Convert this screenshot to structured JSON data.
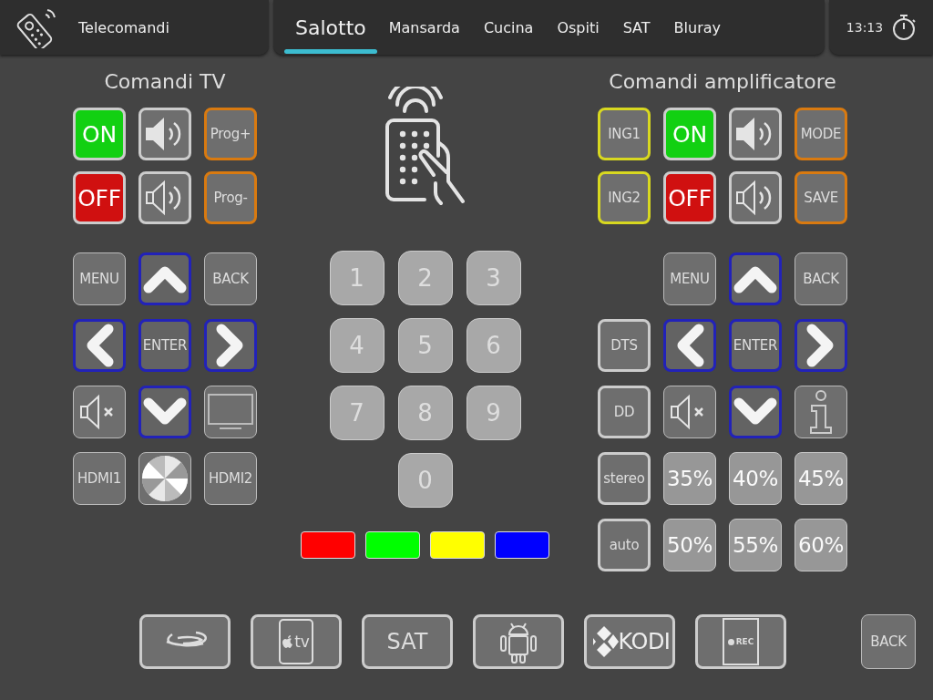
{
  "header": {
    "title": "Telecomandi",
    "tabs": [
      {
        "label": "Salotto",
        "selected": true
      },
      {
        "label": "Mansarda",
        "selected": false
      },
      {
        "label": "Cucina",
        "selected": false
      },
      {
        "label": "Ospiti",
        "selected": false
      },
      {
        "label": "SAT",
        "selected": false
      },
      {
        "label": "Bluray",
        "selected": false
      }
    ],
    "time": "13:13"
  },
  "tv_panel": {
    "title": "Comandi TV",
    "groups": [
      {
        "rows": [
          [
            {
              "kind": "power-on",
              "label": "ON"
            },
            {
              "kind": "vol-up"
            },
            {
              "kind": "program",
              "label": "Prog+"
            }
          ],
          [
            {
              "kind": "power-off",
              "label": "OFF"
            },
            {
              "kind": "vol-down"
            },
            {
              "kind": "program",
              "label": "Prog-"
            }
          ]
        ]
      },
      {
        "rows": [
          [
            {
              "kind": "plain",
              "label": "MENU"
            },
            {
              "kind": "up"
            },
            {
              "kind": "plain",
              "label": "BACK"
            }
          ],
          [
            {
              "kind": "left"
            },
            {
              "kind": "enter",
              "label": "ENTER"
            },
            {
              "kind": "right"
            }
          ],
          [
            {
              "kind": "mute"
            },
            {
              "kind": "down"
            },
            {
              "kind": "tv"
            }
          ],
          [
            {
              "kind": "plain",
              "label": "HDMI1"
            },
            {
              "kind": "disc"
            },
            {
              "kind": "plain",
              "label": "HDMI2"
            }
          ]
        ]
      }
    ]
  },
  "keypad": {
    "rows": [
      [
        "1",
        "2",
        "3"
      ],
      [
        "4",
        "5",
        "6"
      ],
      [
        "7",
        "8",
        "9"
      ],
      [
        null,
        "0",
        null
      ]
    ],
    "color_keys": [
      {
        "color": "#ff0000"
      },
      {
        "color": "#00ff00"
      },
      {
        "color": "#ffff00"
      },
      {
        "color": "#0000ff"
      }
    ]
  },
  "amp_panel": {
    "title": "Comandi amplificatore",
    "groups": [
      {
        "rows": [
          [
            {
              "kind": "input",
              "label": "ING1"
            },
            {
              "kind": "power-on",
              "label": "ON"
            },
            {
              "kind": "vol-up"
            },
            {
              "kind": "program",
              "label": "MODE"
            }
          ],
          [
            {
              "kind": "input",
              "label": "ING2"
            },
            {
              "kind": "power-off",
              "label": "OFF"
            },
            {
              "kind": "vol-down"
            },
            {
              "kind": "program",
              "label": "SAVE"
            }
          ]
        ]
      },
      {
        "rows": [
          [
            null,
            {
              "kind": "plain",
              "label": "MENU"
            },
            {
              "kind": "up"
            },
            {
              "kind": "plain",
              "label": "BACK"
            }
          ],
          [
            {
              "kind": "mode",
              "label": "DTS"
            },
            {
              "kind": "left"
            },
            {
              "kind": "enter",
              "label": "ENTER"
            },
            {
              "kind": "right"
            }
          ],
          [
            {
              "kind": "mode",
              "label": "DD"
            },
            {
              "kind": "mute"
            },
            {
              "kind": "down"
            },
            {
              "kind": "info"
            }
          ],
          [
            {
              "kind": "mode",
              "label": "stereo"
            },
            {
              "kind": "preset",
              "label": "35%"
            },
            {
              "kind": "preset",
              "label": "40%"
            },
            {
              "kind": "preset",
              "label": "45%"
            }
          ],
          [
            {
              "kind": "mode",
              "label": "auto"
            },
            {
              "kind": "preset",
              "label": "50%"
            },
            {
              "kind": "preset",
              "label": "55%"
            },
            {
              "kind": "preset",
              "label": "60%"
            }
          ]
        ]
      }
    ]
  },
  "sources": [
    {
      "kind": "bluray"
    },
    {
      "kind": "appletv",
      "label": "tv"
    },
    {
      "kind": "text",
      "label": "SAT"
    },
    {
      "kind": "android"
    },
    {
      "kind": "kodi",
      "label": "KODI"
    },
    {
      "kind": "rec",
      "label": "REC"
    }
  ],
  "back_button": {
    "label": "BACK"
  }
}
